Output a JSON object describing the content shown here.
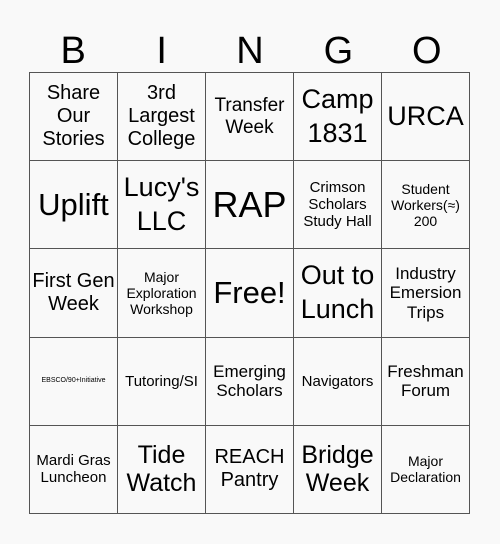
{
  "header": [
    "B",
    "I",
    "N",
    "G",
    "O"
  ],
  "cells": [
    "Share Our Stories",
    "3rd Largest College",
    "Transfer Week",
    "Camp 1831",
    "URCA",
    "Uplift",
    "Lucy's LLC",
    "RAP",
    "Crimson Scholars Study Hall",
    "Student Workers(≈) 200",
    "First Gen Week",
    "Major Exploration Workshop",
    "Free!",
    "Out to Lunch",
    "Industry Emersion Trips",
    "EBSCO/90+Initiative",
    "Tutoring/SI",
    "Emerging Scholars",
    "Navigators",
    "Freshman Forum",
    "Mardi Gras Luncheon",
    "Tide Watch",
    "REACH Pantry",
    "Bridge Week",
    "Major Declaration"
  ]
}
